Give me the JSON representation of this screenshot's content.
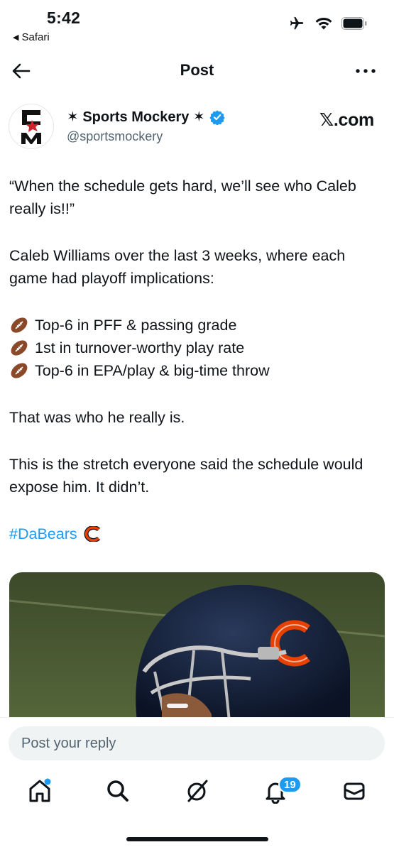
{
  "status_bar": {
    "time": "5:42",
    "back_app": "Safari",
    "icons": [
      "airplane-mode-icon",
      "wifi-icon",
      "battery-icon"
    ]
  },
  "nav": {
    "title": "Post",
    "back_icon": "arrow-left-icon",
    "more_icon": "more-horizontal-icon"
  },
  "author": {
    "name": "✶ Sports Mockery ✶",
    "handle": "@sportsmockery",
    "verified": true,
    "link_text": "𝕏.com"
  },
  "tweet": {
    "quote": "“When the schedule gets hard, we’ll see who Caleb really is!!”",
    "intro": "Caleb Williams over the last 3 weeks, where each game had playoff implications:",
    "bullets": [
      "Top-6 in PFF & passing grade",
      "1st in turnover-worthy play rate",
      "Top-6 in EPA/play & big-time throw"
    ],
    "line1": "That was who he really is.",
    "line2": "This is the stretch everyone said the schedule would expose him. It didn’t.",
    "hashtag": "#DaBears"
  },
  "reply": {
    "placeholder": "Post your reply"
  },
  "tabbar": {
    "items": [
      "home-icon",
      "search-icon",
      "grok-icon",
      "notifications-icon",
      "messages-icon"
    ],
    "notifications_count": "19"
  },
  "colors": {
    "accent": "#1d9bf0",
    "text": "#0f1419",
    "secondary": "#536471",
    "bears_navy": "#0b162a",
    "bears_orange": "#e64100"
  }
}
